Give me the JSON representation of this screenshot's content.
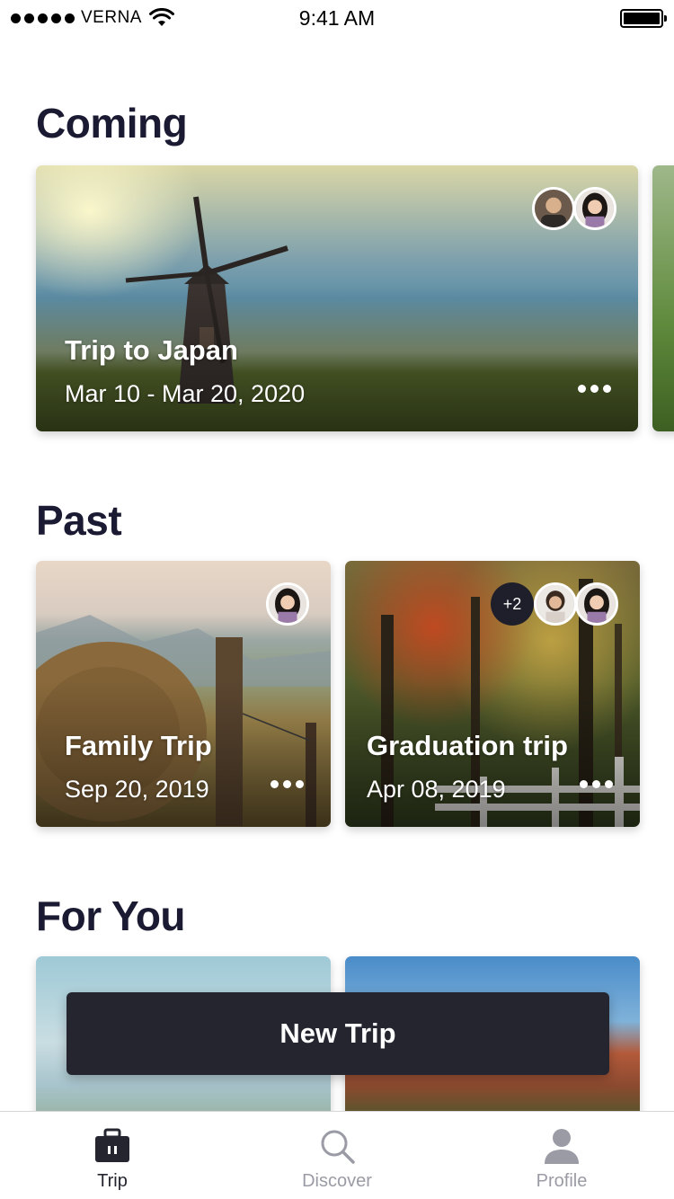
{
  "status_bar": {
    "carrier": "VERNA",
    "time": "9:41 AM"
  },
  "sections": {
    "coming": "Coming",
    "past": "Past",
    "for_you": "For You"
  },
  "coming_trips": [
    {
      "title": "Trip to Japan",
      "dates": "Mar 10 - Mar 20, 2020"
    }
  ],
  "past_trips": [
    {
      "title": "Family Trip",
      "dates": "Sep 20, 2019"
    },
    {
      "title": "Graduation trip",
      "dates": "Apr 08, 2019",
      "extra_members": "+2"
    }
  ],
  "new_trip_label": "New Trip",
  "tabs": [
    {
      "label": "Trip",
      "icon": "suitcase-icon",
      "active": true
    },
    {
      "label": "Discover",
      "icon": "search-icon",
      "active": false
    },
    {
      "label": "Profile",
      "icon": "person-icon",
      "active": false
    }
  ],
  "colors": {
    "heading": "#1b1a33",
    "button_bg": "#24252f",
    "tab_active": "#24252f",
    "tab_inactive": "#9b9ba5"
  }
}
